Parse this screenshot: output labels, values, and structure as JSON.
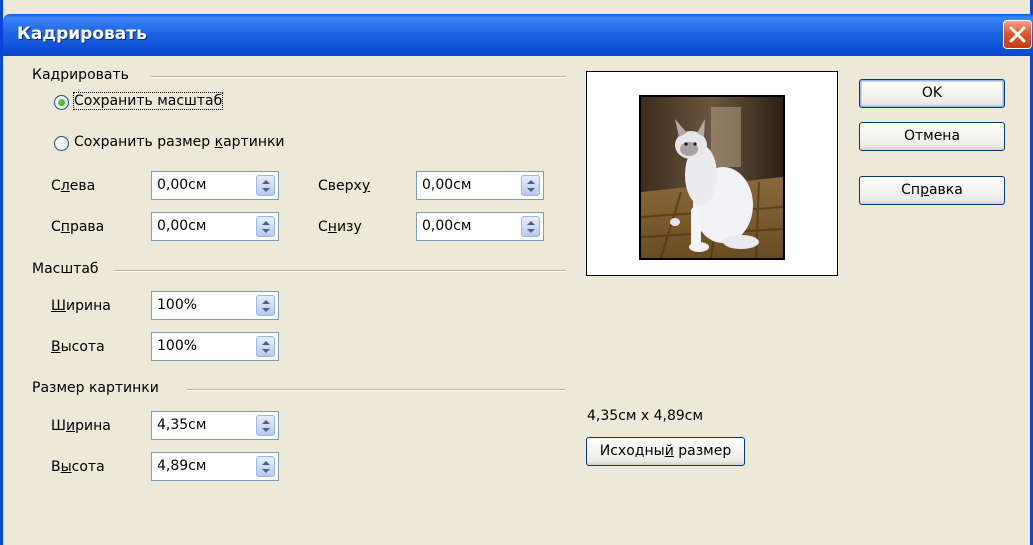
{
  "window": {
    "title": "Кадрировать"
  },
  "crop": {
    "group_label": "Кадрировать",
    "keep_scale": {
      "label": "Сохранить масштаб",
      "checked": true
    },
    "keep_size": {
      "label": "Сохранить размер картинки",
      "checked": false
    },
    "left": {
      "label": "Слева",
      "value": "0,00см"
    },
    "right": {
      "label": "Справа",
      "value": "0,00см"
    },
    "top": {
      "label": "Сверху",
      "value": "0,00см"
    },
    "bottom": {
      "label": "Снизу",
      "value": "0,00см"
    }
  },
  "scale": {
    "group_label": "Масштаб",
    "width": {
      "label": "Ширина",
      "value": "100%"
    },
    "height": {
      "label": "Высота",
      "value": "100%"
    }
  },
  "image_size": {
    "group_label": "Размер картинки",
    "width": {
      "label": "Ширина",
      "value": "4,35см"
    },
    "height": {
      "label": "Высота",
      "value": "4,89см"
    },
    "dimensions_text": "4,35см x 4,89см",
    "original_size_button": "Исходный размер"
  },
  "buttons": {
    "ok": "OK",
    "cancel": "Отмена",
    "help": "Справка"
  },
  "icons": {
    "close": "close-icon",
    "spin": "spin-arrows-icon"
  }
}
